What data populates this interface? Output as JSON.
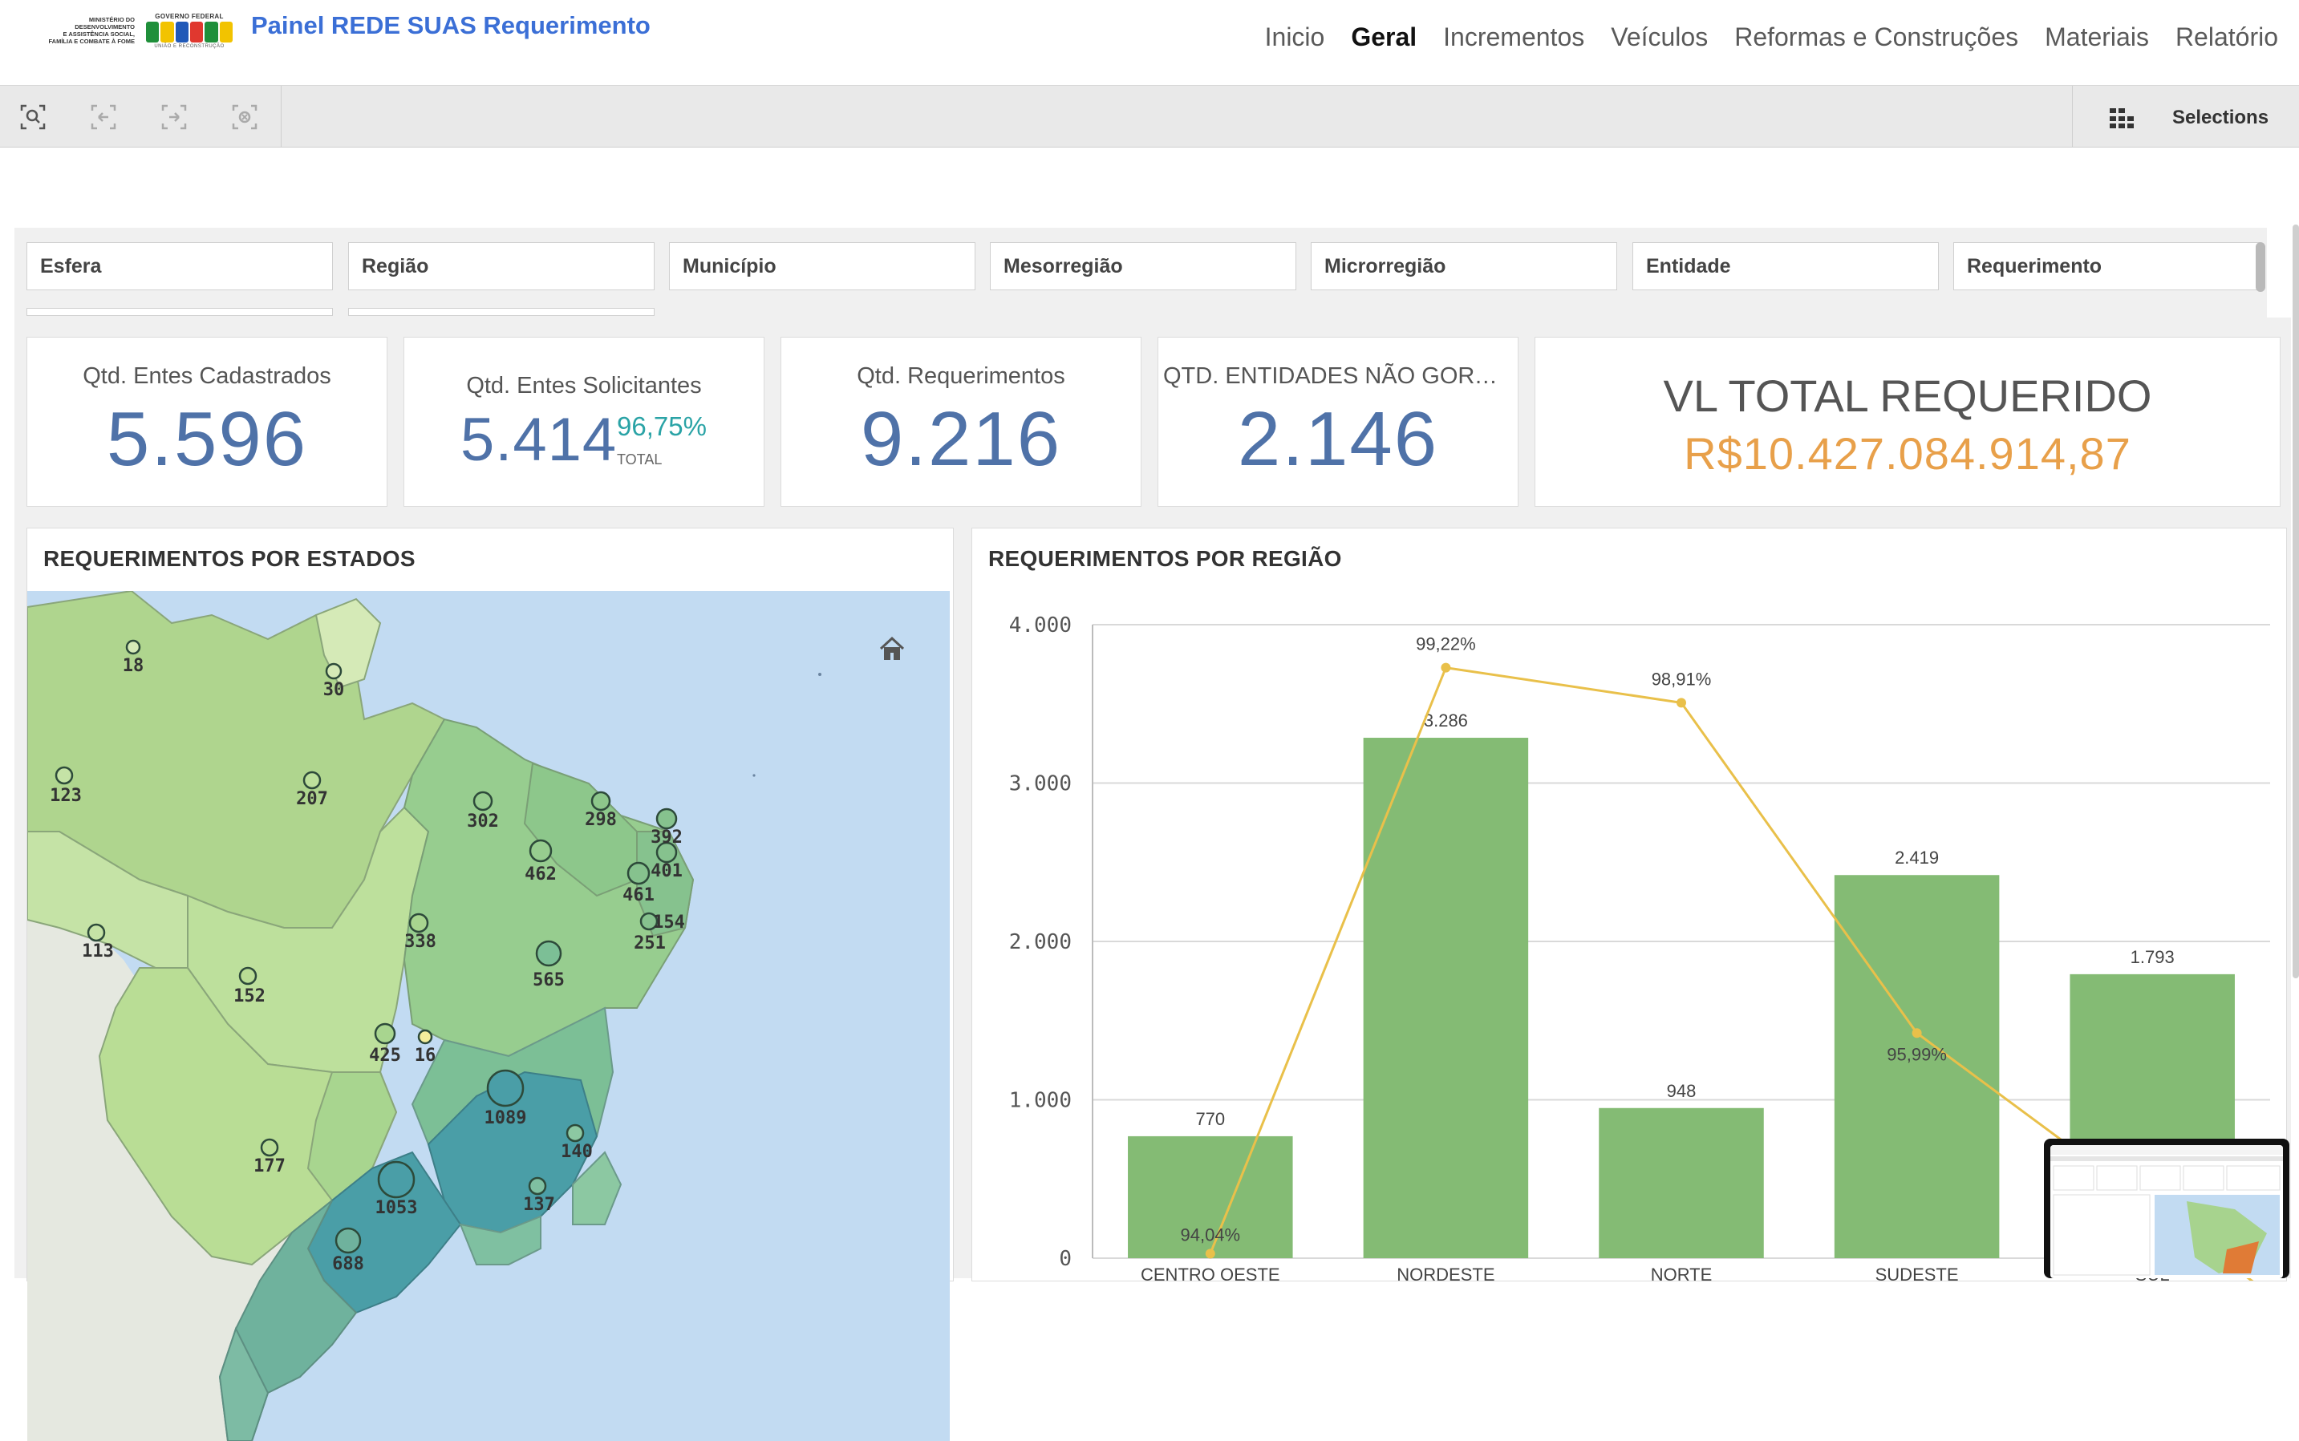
{
  "header": {
    "ministry_logo_lines": [
      "MINISTÉRIO DO",
      "DESENVOLVIMENTO",
      "E ASSISTÊNCIA SOCIAL,",
      "FAMÍLIA E COMBATE À FOME"
    ],
    "gov_logo_top": "GOVERNO FEDERAL",
    "gov_logo_bottom": "UNIÃO E RECONSTRUÇÃO",
    "title": "Painel REDE SUAS Requerimento",
    "nav": [
      {
        "label": "Inicio",
        "active": false
      },
      {
        "label": "Geral",
        "active": true
      },
      {
        "label": "Incrementos",
        "active": false
      },
      {
        "label": "Veículos",
        "active": false
      },
      {
        "label": "Reformas e Construções",
        "active": false
      },
      {
        "label": "Materiais",
        "active": false
      },
      {
        "label": "Relatório",
        "active": false
      }
    ]
  },
  "toolbar": {
    "icons": [
      "smart-search-icon",
      "step-back-icon",
      "step-forward-icon",
      "clear-selections-icon"
    ],
    "selections_label": "Selections"
  },
  "filters": [
    "Esfera",
    "Região",
    "Município",
    "Mesorregião",
    "Microrregião",
    "Entidade",
    "Requerimento"
  ],
  "kpis": {
    "entes_cadastrados": {
      "title": "Qtd. Entes Cadastrados",
      "value": "5.596"
    },
    "entes_solicitantes": {
      "title": "Qtd. Entes Solicitantes",
      "value": "5.414",
      "pct": "96,75%",
      "pct_label": "TOTAL"
    },
    "requerimentos": {
      "title": "Qtd. Requerimentos",
      "value": "9.216"
    },
    "entidades": {
      "title": "QTD. ENTIDADES NÃO GORVER...",
      "value": "2.146"
    },
    "total": {
      "title": "VL TOTAL REQUERIDO",
      "value": "R$10.427.084.914,87"
    }
  },
  "map_panel": {
    "title": "REQUERIMENTOS POR ESTADOS",
    "markers": [
      "18",
      "30",
      "123",
      "207",
      "302",
      "298",
      "392",
      "401",
      "462",
      "461",
      "154",
      "251",
      "338",
      "565",
      "113",
      "152",
      "425",
      "16",
      "1089",
      "177",
      "140",
      "1053",
      "137",
      "688"
    ]
  },
  "chart_panel": {
    "title": "REQUERIMENTOS POR REGIÃO"
  },
  "chart_data": {
    "type": "bar",
    "categories": [
      "CENTRO OESTE",
      "NORDESTE",
      "NORTE",
      "SUDESTE",
      "SUL"
    ],
    "bar_labels": [
      "770",
      "3.286",
      "948",
      "2.419",
      "1.793"
    ],
    "values": [
      770,
      3286,
      948,
      2419,
      1793
    ],
    "line_values_pct": [
      94.04,
      99.22,
      98.91,
      95.99,
      null
    ],
    "line_labels": [
      "94,04%",
      "99,22%",
      "98,91%",
      "95,99%",
      ""
    ],
    "ylim": [
      0,
      4000
    ],
    "yticks": [
      0,
      1000,
      2000,
      3000,
      4000
    ],
    "ytick_labels": [
      "0",
      "1.000",
      "2.000",
      "3.000",
      "4.000"
    ],
    "bar_color": "#84bb74",
    "line_color": "#e9c04a",
    "grid": true
  },
  "colors": {
    "title_blue": "#3b6fd6",
    "kpi_blue": "#4f72a8",
    "pct_teal": "#2aa3a6",
    "money_orange": "#e8a04a",
    "map_water": "#c2dbf2"
  }
}
